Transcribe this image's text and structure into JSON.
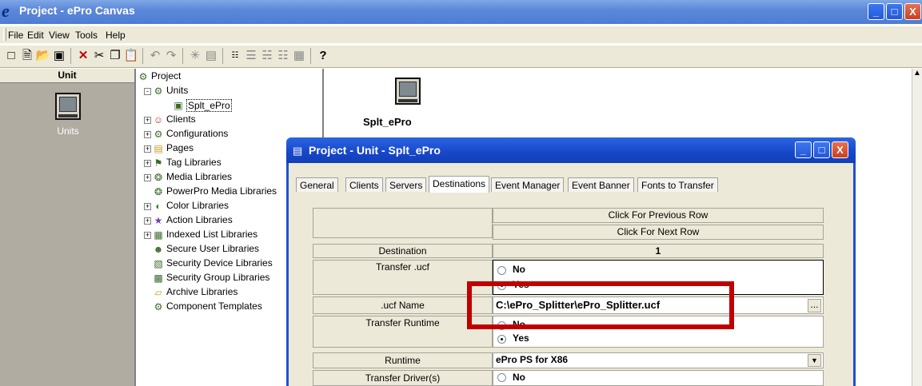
{
  "window": {
    "title": "Project - ePro Canvas",
    "logo_glyph": "e",
    "buttons": [
      "_",
      "□",
      "X"
    ]
  },
  "menu": [
    "File",
    "Edit",
    "View",
    "Tools",
    "Help"
  ],
  "toolbar_icons": [
    "new-icon",
    "open-doc-icon",
    "open-folder-icon",
    "save-icon",
    "delete-icon",
    "cut-icon",
    "copy-icon",
    "paste-icon",
    "undo-icon",
    "redo-icon",
    "asterisk-icon",
    "properties-icon",
    "xml-icon",
    "sort-icon",
    "tree-expand-icon",
    "tree-collapse-icon",
    "grid-icon",
    "help-icon"
  ],
  "unit_panel": {
    "header": "Unit",
    "item_label": "Units"
  },
  "tree": [
    {
      "label": "Project",
      "level": 0,
      "expander": "",
      "icon": "project-icon"
    },
    {
      "label": "Units",
      "level": 1,
      "expander": "-",
      "icon": "units-icon"
    },
    {
      "label": "Splt_ePro",
      "level": 2,
      "expander": "",
      "icon": "monitor-icon"
    },
    {
      "label": "Clients",
      "level": 1,
      "expander": "+",
      "icon": "clients-icon"
    },
    {
      "label": "Configurations",
      "level": 1,
      "expander": "+",
      "icon": "configurations-icon"
    },
    {
      "label": "Pages",
      "level": 1,
      "expander": "+",
      "icon": "pages-icon"
    },
    {
      "label": "Tag Libraries",
      "level": 1,
      "expander": "+",
      "icon": "tag-icon"
    },
    {
      "label": "Media Libraries",
      "level": 1,
      "expander": "+",
      "icon": "media-icon"
    },
    {
      "label": "PowerPro Media Libraries",
      "level": 1,
      "expander": "",
      "icon": "media-icon"
    },
    {
      "label": "Color Libraries",
      "level": 1,
      "expander": "+",
      "icon": "color-icon"
    },
    {
      "label": "Action Libraries",
      "level": 1,
      "expander": "+",
      "icon": "action-icon"
    },
    {
      "label": "Indexed List Libraries",
      "level": 1,
      "expander": "+",
      "icon": "list-icon"
    },
    {
      "label": "Secure User Libraries",
      "level": 1,
      "expander": "",
      "icon": "user-icon"
    },
    {
      "label": "Security Device Libraries",
      "level": 1,
      "expander": "",
      "icon": "device-icon"
    },
    {
      "label": "Security Group Libraries",
      "level": 1,
      "expander": "",
      "icon": "group-icon"
    },
    {
      "label": "Archive Libraries",
      "level": 1,
      "expander": "",
      "icon": "archive-icon"
    },
    {
      "label": "Component Templates",
      "level": 1,
      "expander": "",
      "icon": "template-icon"
    }
  ],
  "canvas": {
    "unit_label": "Splt_ePro"
  },
  "dialog": {
    "title": "Project - Unit - Splt_ePro",
    "buttons": [
      "_",
      "□",
      "X"
    ],
    "tabs": [
      "General",
      "Clients",
      "Servers",
      "Destinations",
      "Event Manager",
      "Event Banner",
      "Fonts to Transfer"
    ],
    "selected_tab": "Destinations",
    "prev_row": "Click For Previous Row",
    "next_row": "Click For Next Row",
    "rows": {
      "destination": {
        "label": "Destination",
        "value": "1"
      },
      "transfer_ucf": {
        "label": "Transfer .ucf",
        "no": "No",
        "yes": "Yes"
      },
      "ucf_name": {
        "label": ".ucf Name",
        "value": "C:\\ePro_Splitter\\ePro_Splitter.ucf",
        "browse": "..."
      },
      "transfer_runtime": {
        "label": "Transfer Runtime",
        "no": "No",
        "yes": "Yes"
      },
      "runtime": {
        "label": "Runtime",
        "value": "ePro PS for X86"
      },
      "transfer_drivers": {
        "label": "Transfer Driver(s)",
        "no": "No"
      }
    }
  },
  "colors": {
    "highlight_box": "#c00000",
    "titlebar": "#4f7dd3"
  }
}
